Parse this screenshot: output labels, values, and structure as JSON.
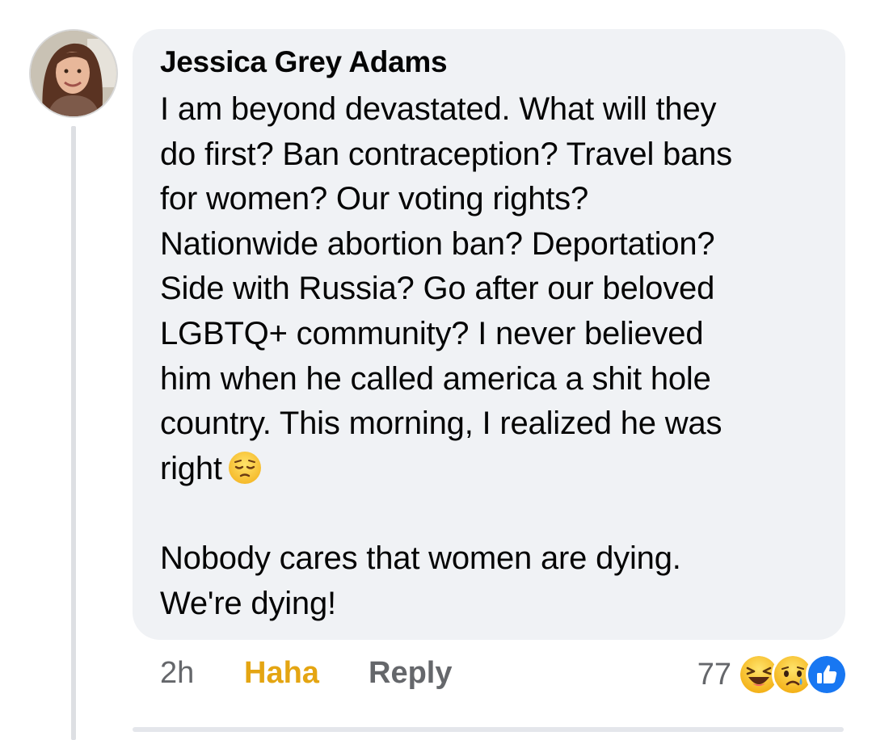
{
  "comment": {
    "author": "Jessica Grey Adams",
    "body_lines": [
      "I am beyond devastated. What will they",
      "do first? Ban contraception? Travel bans",
      "for women? Our voting rights?",
      "Nationwide abortion ban? Deportation?",
      "Side with Russia? Go after our beloved",
      "LGBTQ+ community? I never believed",
      "him when he called america a shit hole",
      "country. This morning, I realized he was",
      "right"
    ],
    "body_emoji": "pensive-face-icon",
    "body_lines_2": [
      "Nobody cares that women are dying.",
      "We're dying!"
    ]
  },
  "actions": {
    "time": "2h",
    "reaction_label": "Haha",
    "reply_label": "Reply"
  },
  "reactions": {
    "count": "77",
    "icons": [
      "haha-icon",
      "sad-icon",
      "like-icon"
    ]
  },
  "colors": {
    "bubble": "#f0f2f5",
    "haha": "#e4a512",
    "meta_text": "#65676b",
    "like_blue": "#1877f2"
  }
}
